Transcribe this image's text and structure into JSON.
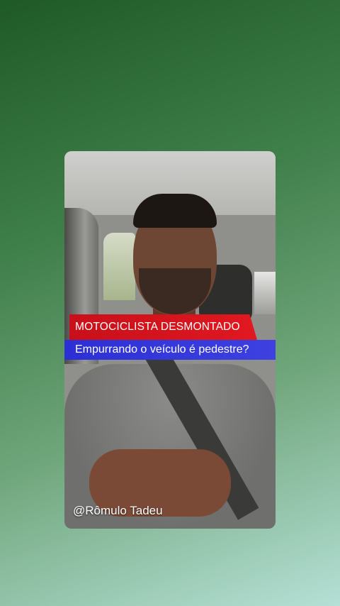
{
  "video": {
    "headline": "MOTOCICLISTA DESMONTADO",
    "subheadline": "Empurrando o veículo é pedestre?",
    "handle": "@Rômulo Tadeu"
  },
  "colors": {
    "background_top": "#1f5a26",
    "background_bottom": "#b5e0d6",
    "headline_bar": "#e11820",
    "subheadline_bar": "#3e41e0"
  }
}
